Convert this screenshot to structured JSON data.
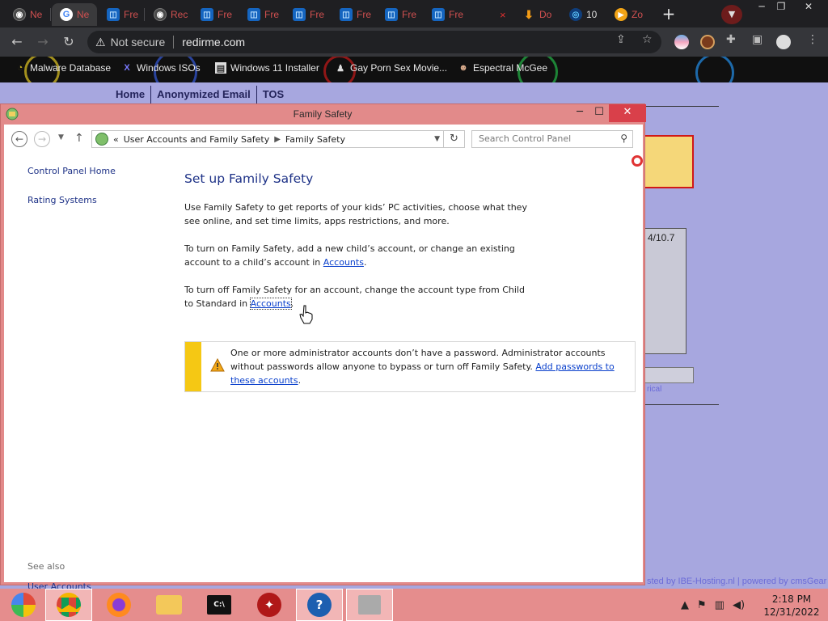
{
  "browser": {
    "tabs": [
      {
        "label": "Ne",
        "icon": "globe-icon"
      },
      {
        "label": "Ne",
        "icon": "google-icon"
      },
      {
        "label": "Fre",
        "icon": "box-icon"
      },
      {
        "label": "Rec",
        "icon": "globe-icon"
      },
      {
        "label": "Fre",
        "icon": "box-icon"
      },
      {
        "label": "Fre",
        "icon": "box-icon"
      },
      {
        "label": "Fre",
        "icon": "box-icon"
      },
      {
        "label": "Fre",
        "icon": "box-icon"
      },
      {
        "label": "Fre",
        "icon": "box-icon"
      },
      {
        "label": "Fre",
        "icon": "box-icon"
      },
      {
        "label": "×",
        "icon": "close-icon"
      },
      {
        "label": "Do",
        "icon": "download-icon"
      },
      {
        "label": "10",
        "icon": "eye-icon"
      },
      {
        "label": "Zo",
        "icon": "play-icon"
      }
    ],
    "url_warning": "Not secure",
    "url": "redirme.com",
    "bookmarks": [
      "Malware Database",
      "Windows ISOs",
      "Windows 11 Installer",
      "Gay Porn Sex Movie...",
      "Espectral McGee"
    ]
  },
  "website": {
    "nav": [
      "Home",
      "Anonymized Email",
      "TOS"
    ],
    "textarea_fragment": "4/10.7",
    "link_fragment": "rical",
    "footer": "sted by IBE-Hosting.nl  |  powered by cmsGear"
  },
  "window": {
    "title": "Family Safety",
    "breadcrumb": {
      "prefix": "«",
      "parent": "User Accounts and Family Safety",
      "current": "Family Safety"
    },
    "search_placeholder": "Search Control Panel",
    "left_links": [
      "Control Panel Home",
      "Rating Systems"
    ],
    "see_also_label": "See also",
    "see_also_link": "User Accounts",
    "heading": "Set up Family Safety",
    "para1": "Use Family Safety to get reports of your kids’ PC activities, choose what they see online, and set time limits, apps restrictions, and more.",
    "para2_text": "To turn on Family Safety, add a new child’s account, or change an existing account to a child’s account in",
    "para2_link": "Accounts",
    "para3_text": "To turn off Family Safety for an account, change the account type from Child to Standard in",
    "para3_link": "Accounts",
    "period": ".",
    "warning_text": "One or more administrator accounts don’t have a password. Administrator accounts without passwords allow anyone to bypass or turn off Family Safety.",
    "warning_link": "Add passwords to these accounts"
  },
  "taskbar": {
    "time": "2:18 PM",
    "date": "12/31/2022"
  },
  "colors": {
    "window_frame": "#e28a8a",
    "close_button": "#d9404a",
    "link": "#0a40cc",
    "heading": "#1e3287",
    "warning_stripe": "#f5c814",
    "page_bg": "#a7a7df"
  }
}
